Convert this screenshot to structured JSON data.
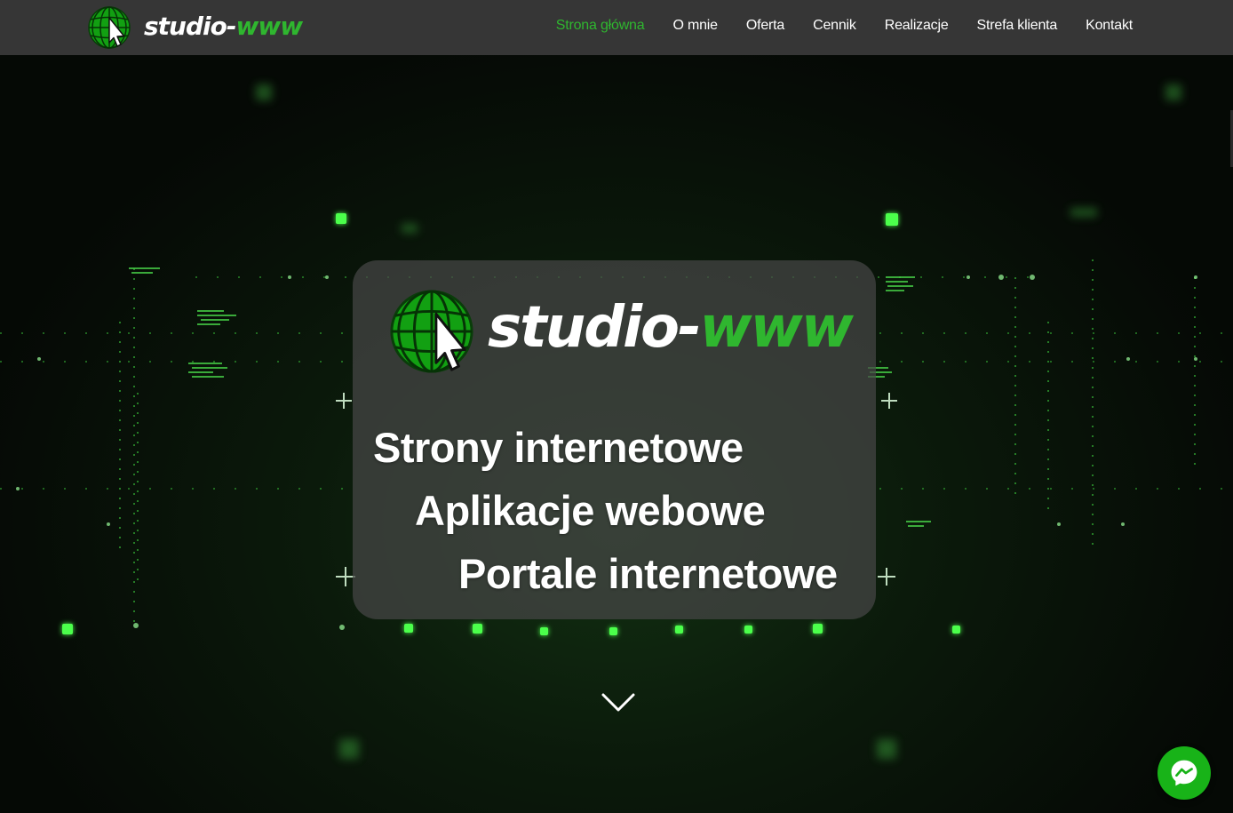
{
  "brand": {
    "name_main": "studio-",
    "name_accent": "www",
    "logo_icon": "globe-cursor-icon",
    "accent_color": "#2fb62f"
  },
  "nav": {
    "items": [
      {
        "label": "Strona główna",
        "active": true
      },
      {
        "label": "O mnie",
        "active": false
      },
      {
        "label": "Oferta",
        "active": false
      },
      {
        "label": "Cennik",
        "active": false
      },
      {
        "label": "Realizacje",
        "active": false
      },
      {
        "label": "Strefa klienta",
        "active": false
      },
      {
        "label": "Kontakt",
        "active": false
      }
    ]
  },
  "hero": {
    "lines": [
      "Strony internetowe",
      "Aplikacje webowe",
      "Portale internetowe"
    ],
    "scroll_icon": "chevron-down-icon"
  },
  "chat_widget": {
    "icon": "messenger-icon",
    "color": "#18b318"
  }
}
